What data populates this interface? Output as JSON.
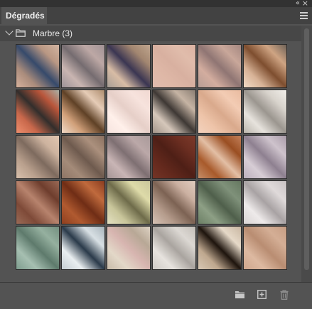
{
  "panel": {
    "tab_label": "Dégradés",
    "collapse_glyph": "«",
    "close_glyph": "×",
    "menu_icon": "hamburger-menu-icon"
  },
  "group": {
    "label": "Marbre (3)",
    "expanded": true,
    "toggle_icon": "chevron-down-icon",
    "folder_icon": "folder-icon"
  },
  "gradients": [
    {
      "angle": 45,
      "stops": [
        "#d7b29d",
        "#aa8c7c",
        "#364a6b",
        "#b99783",
        "#d3b5a2"
      ]
    },
    {
      "angle": 45,
      "stops": [
        "#9c9297",
        "#c9b5b1",
        "#756c70",
        "#bda8a5",
        "#a09295"
      ]
    },
    {
      "angle": 45,
      "stops": [
        "#a79e96",
        "#d8bca5",
        "#3b3652",
        "#a28670",
        "#c0a68f"
      ]
    },
    {
      "angle": 45,
      "stops": [
        "#e0bbae",
        "#dfb8a7",
        "#d8b0a0",
        "#e0bcab",
        "#dcb3a3"
      ]
    },
    {
      "angle": 45,
      "stops": [
        "#b89d94",
        "#d3ad9f",
        "#8f7573",
        "#c9a79a",
        "#a48780"
      ]
    },
    {
      "angle": 45,
      "stops": [
        "#f3dcc6",
        "#d7b296",
        "#7e4e2f",
        "#cfa483",
        "#6e6258"
      ]
    },
    {
      "angle": 45,
      "stops": [
        "#ee8f6e",
        "#c9684b",
        "#322e2c",
        "#b9553a",
        "#aab1a6"
      ]
    },
    {
      "angle": 45,
      "stops": [
        "#f1dac7",
        "#d1a07a",
        "#5f4126",
        "#e6ccb7",
        "#ad8d6e"
      ]
    },
    {
      "angle": 45,
      "stops": [
        "#f6e4df",
        "#fff0ea",
        "#e6cfc8",
        "#f7e3dd",
        "#f0d8d1"
      ]
    },
    {
      "angle": 45,
      "stops": [
        "#a3958a",
        "#d5c7ba",
        "#3e3834",
        "#c6b4a4",
        "#8a7e73"
      ]
    },
    {
      "angle": 45,
      "stops": [
        "#f3d2bd",
        "#eec4a9",
        "#d9a98c",
        "#f3ccb4",
        "#e9bba0"
      ]
    },
    {
      "angle": 45,
      "stops": [
        "#bab5ac",
        "#e7e3dd",
        "#9b968f",
        "#d8d3cc",
        "#f2efea"
      ]
    },
    {
      "angle": 45,
      "stops": [
        "#d9c1ad",
        "#b9a08d",
        "#7d6a5e",
        "#cdb39f",
        "#e1c6b0"
      ]
    },
    {
      "angle": 45,
      "stops": [
        "#8e7565",
        "#a48b79",
        "#6e5a4e",
        "#ab907d",
        "#8a7160"
      ]
    },
    {
      "angle": 45,
      "stops": [
        "#a59595",
        "#c9b5b5",
        "#7e6f72",
        "#bba8a8",
        "#a99a9a"
      ]
    },
    {
      "angle": 45,
      "stops": [
        "#743426",
        "#64291d",
        "#4e1f16",
        "#6b2e21",
        "#7c3a2b"
      ]
    },
    {
      "angle": 45,
      "stops": [
        "#c58e68",
        "#a85a2b",
        "#e3bfa5",
        "#9a4e22",
        "#c3805a"
      ]
    },
    {
      "angle": 45,
      "stops": [
        "#bcb0bd",
        "#d7cdd5",
        "#8e8090",
        "#cec3cc",
        "#a99ba9"
      ]
    },
    {
      "angle": 45,
      "stops": [
        "#9b6b57",
        "#7e4a38",
        "#b7836d",
        "#6e3d2d",
        "#9a6955"
      ]
    },
    {
      "angle": 45,
      "stops": [
        "#8f3f1f",
        "#b05a30",
        "#6f2d15",
        "#c06a3d",
        "#8a3c1f"
      ]
    },
    {
      "angle": 45,
      "stops": [
        "#e4e1c2",
        "#c8c59a",
        "#6e6b4a",
        "#dedba9",
        "#c9c69b"
      ]
    },
    {
      "angle": 45,
      "stops": [
        "#d5c1b4",
        "#b59c8c",
        "#7c6253",
        "#cbb0a1",
        "#e2cdbf"
      ]
    },
    {
      "angle": 45,
      "stops": [
        "#6c7f65",
        "#8d9f85",
        "#4f5f4b",
        "#7f917a",
        "#657860"
      ]
    },
    {
      "angle": 45,
      "stops": [
        "#d9d4d4",
        "#eeeaea",
        "#a8a2a3",
        "#dfdada",
        "#c9c3c4"
      ]
    },
    {
      "angle": 45,
      "stops": [
        "#7e9d8e",
        "#a6bfb1",
        "#5e7a6c",
        "#95b09f",
        "#738f80"
      ]
    },
    {
      "angle": 45,
      "stops": [
        "#c5cdd2",
        "#e9eef0",
        "#2a3a4a",
        "#d8e0e4",
        "#a8b4bb"
      ]
    },
    {
      "angle": 45,
      "stops": [
        "#c8bba9",
        "#e3d8c8",
        "#d7b5b0",
        "#b8a896",
        "#ddd2c3"
      ]
    },
    {
      "angle": 45,
      "stops": [
        "#cfcbc6",
        "#e7e3de",
        "#a9a49f",
        "#dcd8d3",
        "#c3beb8"
      ]
    },
    {
      "angle": 45,
      "stops": [
        "#d8c8b4",
        "#bfa88f",
        "#1e140d",
        "#e6d9c8",
        "#c9b7a2"
      ]
    },
    {
      "angle": 45,
      "stops": [
        "#cfa78d",
        "#ddb9a1",
        "#b98d72",
        "#d4ae95",
        "#c69d83"
      ]
    }
  ],
  "footer": {
    "new_group_icon": "folder-icon",
    "new_gradient_icon": "add-square-icon",
    "delete_icon": "trash-icon"
  }
}
